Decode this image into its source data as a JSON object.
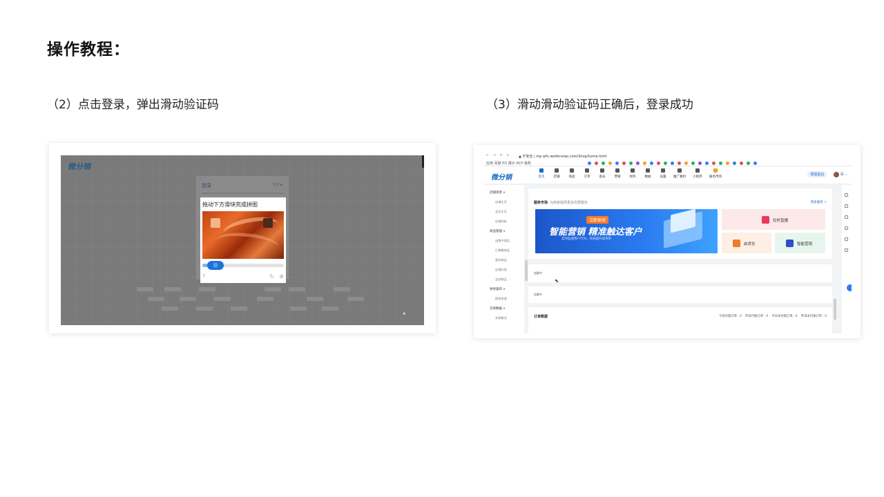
{
  "slide": {
    "title": "操作教程：",
    "step2_caption": "（2）点击登录，弹出滑动验证码",
    "step3_caption": "（3）滑动滑动验证码正确后，登录成功"
  },
  "left_shot": {
    "logo": "微分销",
    "login_title": "登录",
    "register_link": "注册 ▶",
    "captcha_title": "拖动下方滑块完成拼图",
    "slider_handle": "|||",
    "help_icon": "?",
    "refresh_icon": "↻",
    "close_icon": "⊗",
    "slider_progress": 0.18
  },
  "right_shot": {
    "browser": {
      "nav": "← → ✕ ⌂",
      "url": "▲ 不安全 | mp.wfx.weifenxiao.com/Shop/home.html"
    },
    "bookmarks": "应用  百度  ED  报价  ACP  易购",
    "logo": "微分销",
    "nav_items": [
      "首页",
      "店铺",
      "商品",
      "订单",
      "会员",
      "营销",
      "财务",
      "数据",
      "设置",
      "推广素材",
      "小程序",
      "服务市场"
    ],
    "header_badge": "体验后台",
    "header_user": "哥 ⌵",
    "sidebar": {
      "groups": [
        {
          "head": "店铺装修 ∧",
          "items": [
            "店铺主页",
            "会员主页",
            "店铺导航"
          ]
        },
        {
          "head": "商品管理 ∧",
          "items": [
            "出售中商品",
            "已售罄商品",
            "暂存商品",
            "店铺分类",
            "全部商品"
          ]
        },
        {
          "head": "财务操作 ∧",
          "items": [
            "提现申请"
          ]
        },
        {
          "head": "交易数据 ∧",
          "items": [
            "交易概况"
          ]
        }
      ]
    },
    "service_market": {
      "title": "服务市场",
      "subtitle": "为商家提供更多优质服务",
      "more": "更多服务 >",
      "banner_tag": "立即体验",
      "banner_headline": "智能营销 精准触达客户",
      "banner_sub": "实时监测用户行为，有效提升成单率",
      "promos": [
        "拉时直播",
        "启货仓",
        "智能营销"
      ]
    },
    "loading1": "加载中",
    "loading2": "加载中",
    "orders": {
      "title": "订单数据",
      "stats": "今日付款订单：0   昨日付款订单：0   今日未付款订单：0   昨日未付款订单：0"
    },
    "colors": {
      "brand": "#1c68c9",
      "promo_live": "#fde8ea",
      "promo_warehouse": "#fdefe3",
      "promo_marketing": "#e6f6ee"
    }
  }
}
